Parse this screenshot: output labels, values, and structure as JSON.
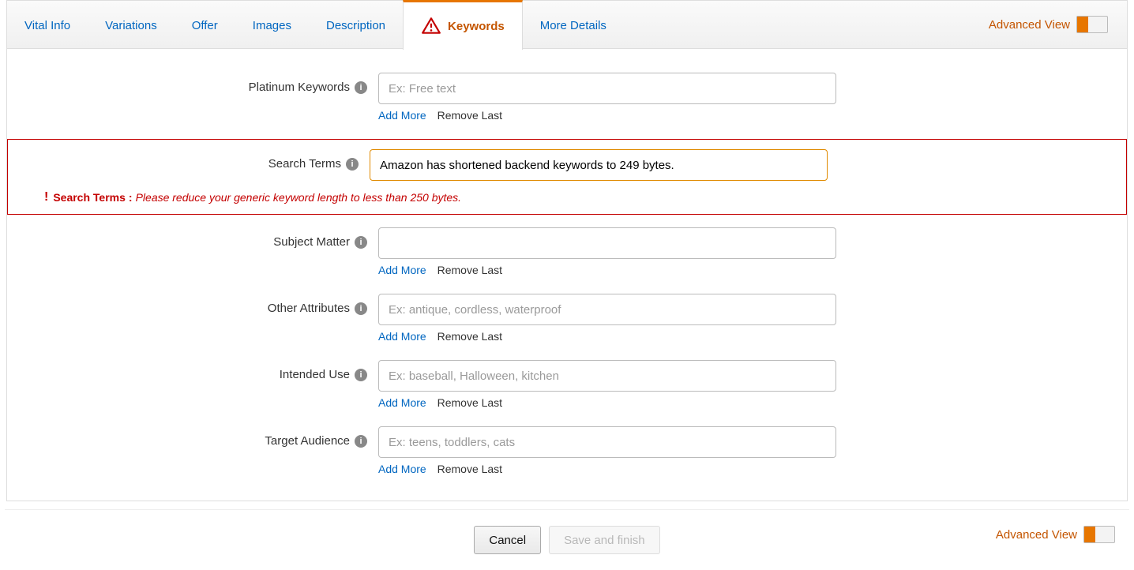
{
  "tabs": {
    "vital": "Vital Info",
    "variations": "Variations",
    "offer": "Offer",
    "images": "Images",
    "description": "Description",
    "keywords": "Keywords",
    "more": "More Details"
  },
  "advanced_view": "Advanced View",
  "fields": {
    "platinum": {
      "label": "Platinum Keywords",
      "value": "",
      "placeholder": "Ex: Free text"
    },
    "search": {
      "label": "Search Terms",
      "value": "Amazon has shortened backend keywords to 249 bytes.",
      "placeholder": ""
    },
    "subject": {
      "label": "Subject Matter",
      "value": "",
      "placeholder": ""
    },
    "other": {
      "label": "Other Attributes",
      "value": "",
      "placeholder": "Ex: antique, cordless, waterproof"
    },
    "intended": {
      "label": "Intended Use",
      "value": "",
      "placeholder": "Ex: baseball, Halloween, kitchen"
    },
    "target": {
      "label": "Target Audience",
      "value": "",
      "placeholder": "Ex: teens, toddlers, cats"
    }
  },
  "actions": {
    "add": "Add More",
    "remove": "Remove Last"
  },
  "error": {
    "field": "Search Terms",
    "msg": "Please reduce your generic keyword length to less than 250 bytes."
  },
  "buttons": {
    "cancel": "Cancel",
    "save": "Save and finish"
  }
}
